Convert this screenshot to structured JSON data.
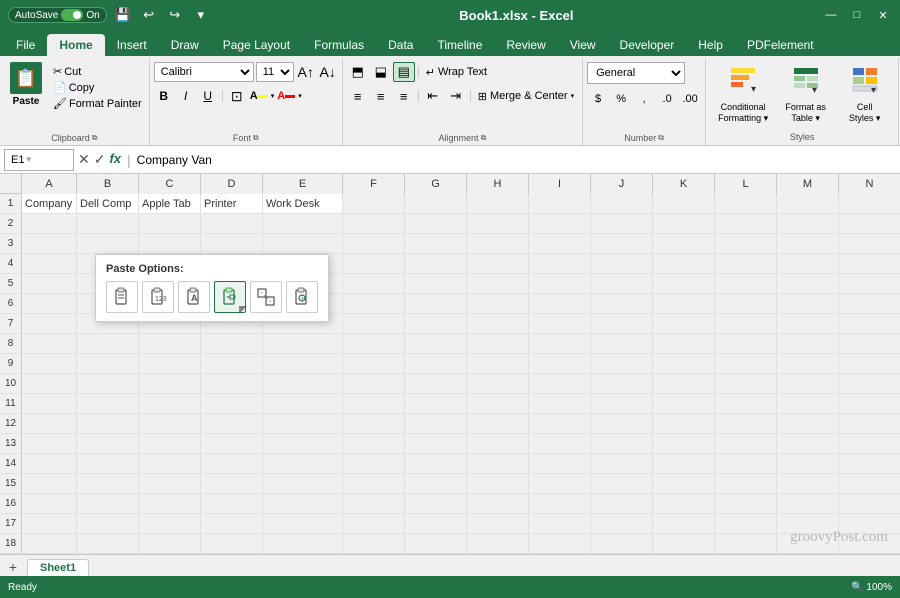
{
  "titlebar": {
    "autosave_label": "AutoSave",
    "toggle_state": "On",
    "title": "Book1.xlsx - Excel",
    "win_buttons": [
      "—",
      "□",
      "✕"
    ]
  },
  "ribbon_tabs": [
    {
      "label": "File",
      "active": false
    },
    {
      "label": "Home",
      "active": true
    },
    {
      "label": "Insert",
      "active": false
    },
    {
      "label": "Draw",
      "active": false
    },
    {
      "label": "Page Layout",
      "active": false
    },
    {
      "label": "Formulas",
      "active": false
    },
    {
      "label": "Data",
      "active": false
    },
    {
      "label": "Timeline",
      "active": false
    },
    {
      "label": "Review",
      "active": false
    },
    {
      "label": "View",
      "active": false
    },
    {
      "label": "Developer",
      "active": false
    },
    {
      "label": "Help",
      "active": false
    },
    {
      "label": "PDFelement",
      "active": false
    }
  ],
  "clipboard": {
    "group_label": "Clipboard",
    "paste_label": "Paste",
    "cut_label": "Cut",
    "copy_label": "Copy",
    "format_painter_label": "Format Painter"
  },
  "font": {
    "group_label": "Font",
    "font_name": "Calibri",
    "font_size": "11",
    "bold_label": "B",
    "italic_label": "I",
    "underline_label": "U"
  },
  "alignment": {
    "group_label": "Alignment",
    "wrap_text_label": "Wrap Text",
    "merge_center_label": "Merge & Center"
  },
  "number": {
    "group_label": "Number",
    "format": "General"
  },
  "styles": {
    "group_label": "Styles",
    "conditional_label": "Conditional\nFormatting",
    "format_table_label": "Format as\nTable",
    "cell_styles_label": "Cell\nStyles"
  },
  "formula_bar": {
    "name_box": "E1",
    "formula": "Company Van"
  },
  "grid": {
    "columns": [
      "A",
      "B",
      "C",
      "D",
      "E",
      "F",
      "G",
      "H",
      "I",
      "J",
      "K",
      "L",
      "M",
      "N"
    ],
    "rows": [
      {
        "num": 1,
        "cells": [
          "Company",
          "Dell Comp",
          "Apple Tab",
          "Printer",
          "Work Desk",
          "",
          "",
          "",
          "",
          "",
          "",
          "",
          "",
          ""
        ]
      },
      {
        "num": 2,
        "cells": [
          "",
          "",
          "",
          "",
          "",
          "",
          "",
          "",
          "",
          "",
          "",
          "",
          "",
          ""
        ]
      },
      {
        "num": 3,
        "cells": [
          "",
          "",
          "",
          "",
          "",
          "",
          "",
          "",
          "",
          "",
          "",
          "",
          "",
          ""
        ]
      },
      {
        "num": 4,
        "cells": [
          "",
          "",
          "",
          "",
          "",
          "",
          "",
          "",
          "",
          "",
          "",
          "",
          "",
          ""
        ]
      },
      {
        "num": 5,
        "cells": [
          "",
          "",
          "",
          "",
          "",
          "",
          "",
          "",
          "",
          "",
          "",
          "",
          "",
          ""
        ]
      },
      {
        "num": 6,
        "cells": [
          "",
          "",
          "",
          "",
          "",
          "",
          "",
          "",
          "",
          "",
          "",
          "",
          "",
          ""
        ]
      },
      {
        "num": 7,
        "cells": [
          "",
          "",
          "",
          "",
          "",
          "",
          "",
          "",
          "",
          "",
          "",
          "",
          "",
          ""
        ]
      },
      {
        "num": 8,
        "cells": [
          "",
          "",
          "",
          "",
          "",
          "",
          "",
          "",
          "",
          "",
          "",
          "",
          "",
          ""
        ]
      },
      {
        "num": 9,
        "cells": [
          "",
          "",
          "",
          "",
          "",
          "",
          "",
          "",
          "",
          "",
          "",
          "",
          "",
          ""
        ]
      },
      {
        "num": 10,
        "cells": [
          "",
          "",
          "",
          "",
          "",
          "",
          "",
          "",
          "",
          "",
          "",
          "",
          "",
          ""
        ]
      },
      {
        "num": 11,
        "cells": [
          "",
          "",
          "",
          "",
          "",
          "",
          "",
          "",
          "",
          "",
          "",
          "",
          "",
          ""
        ]
      },
      {
        "num": 12,
        "cells": [
          "",
          "",
          "",
          "",
          "",
          "",
          "",
          "",
          "",
          "",
          "",
          "",
          "",
          ""
        ]
      },
      {
        "num": 13,
        "cells": [
          "",
          "",
          "",
          "",
          "",
          "",
          "",
          "",
          "",
          "",
          "",
          "",
          "",
          ""
        ]
      },
      {
        "num": 14,
        "cells": [
          "",
          "",
          "",
          "",
          "",
          "",
          "",
          "",
          "",
          "",
          "",
          "",
          "",
          ""
        ]
      },
      {
        "num": 15,
        "cells": [
          "",
          "",
          "",
          "",
          "",
          "",
          "",
          "",
          "",
          "",
          "",
          "",
          "",
          ""
        ]
      },
      {
        "num": 16,
        "cells": [
          "",
          "",
          "",
          "",
          "",
          "",
          "",
          "",
          "",
          "",
          "",
          "",
          "",
          ""
        ]
      },
      {
        "num": 17,
        "cells": [
          "",
          "",
          "",
          "",
          "",
          "",
          "",
          "",
          "",
          "",
          "",
          "",
          "",
          ""
        ]
      },
      {
        "num": 18,
        "cells": [
          "",
          "",
          "",
          "",
          "",
          "",
          "",
          "",
          "",
          "",
          "",
          "",
          "",
          ""
        ]
      }
    ]
  },
  "paste_options": {
    "title": "Paste Options:",
    "buttons": [
      "📋",
      "📊",
      "A",
      "🔗",
      "✏️",
      "🖼️"
    ]
  },
  "sheet_tabs": [
    {
      "label": "Sheet1",
      "active": true
    }
  ],
  "status_bar": {
    "left": "Ready",
    "zoom": "100%"
  },
  "watermark": "groovyPost.com"
}
